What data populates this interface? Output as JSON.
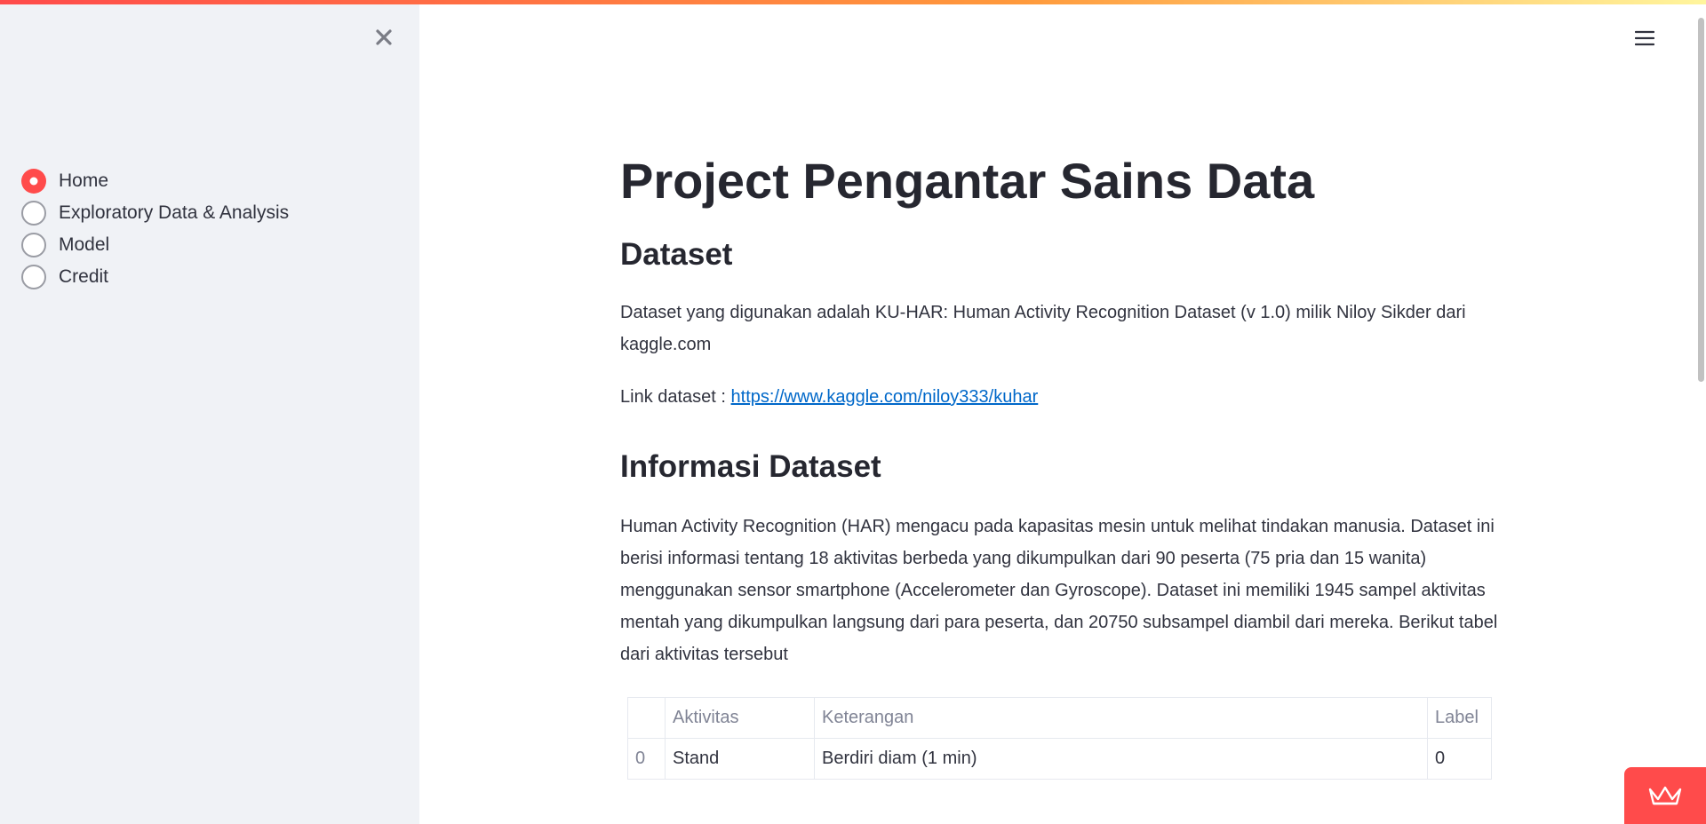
{
  "sidebar": {
    "close_icon": "close-icon",
    "nav_items": [
      {
        "label": "Home",
        "selected": true
      },
      {
        "label": "Exploratory Data & Analysis",
        "selected": false
      },
      {
        "label": "Model",
        "selected": false
      },
      {
        "label": "Credit",
        "selected": false
      }
    ]
  },
  "header": {
    "menu_icon": "hamburger-menu-icon"
  },
  "main": {
    "title": "Project Pengantar Sains Data",
    "dataset_heading": "Dataset",
    "dataset_text": "Dataset yang digunakan adalah KU-HAR: Human Activity Recognition Dataset (v 1.0) milik Niloy Sikder dari kaggle.com",
    "link_prefix": "Link dataset : ",
    "link_text": "https://www.kaggle.com/niloy333/kuhar",
    "info_heading": "Informasi Dataset",
    "info_text": "Human Activity Recognition (HAR) mengacu pada kapasitas mesin untuk melihat tindakan manusia. Dataset ini berisi informasi tentang 18 aktivitas berbeda yang dikumpulkan dari 90 peserta (75 pria dan 15 wanita) menggunakan sensor smartphone (Accelerometer dan Gyroscope). Dataset ini memiliki 1945 sampel aktivitas mentah yang dikumpulkan langsung dari para peserta, dan 20750 subsampel diambil dari mereka. Berikut tabel dari aktivitas tersebut",
    "table": {
      "columns": [
        "",
        "Aktivitas",
        "Keterangan",
        "Label"
      ],
      "rows": [
        [
          "0",
          "Stand",
          "Berdiri diam (1 min)",
          "0"
        ]
      ]
    }
  },
  "colors": {
    "accent": "#ff4b4b",
    "sidebar_bg": "#f0f2f6",
    "link": "#0068c9",
    "text": "#262730"
  },
  "badge": {
    "icon": "streamlit-crown-icon"
  }
}
